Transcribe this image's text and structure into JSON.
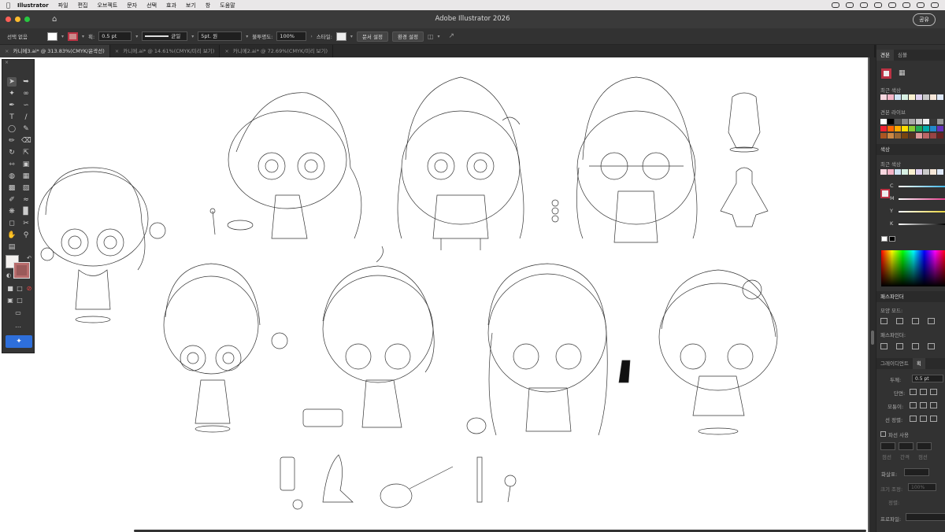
{
  "menubar": {
    "app_name": "Illustrator",
    "items": [
      "파일",
      "편집",
      "오브젝트",
      "문자",
      "선택",
      "효과",
      "보기",
      "창",
      "도움말"
    ],
    "clock": ""
  },
  "window": {
    "title": "Adobe Illustrator 2026",
    "share_label": "공유"
  },
  "control_bar": {
    "selection_label": "선택 없음",
    "stroke_label": "획:",
    "stroke_value": "0.5 pt",
    "profile_label": "균일",
    "brush_value": "5pt. 원",
    "opacity_label": "불투명도:",
    "opacity_value": "100%",
    "style_label": "스타일:",
    "doc_setup_label": "문서 설정",
    "prefs_label": "환경 설정"
  },
  "tabs": [
    {
      "label": "카니메3.ai* @ 313.83%(CMYK/윤곽선)",
      "active": true
    },
    {
      "label": "카니메.ai* @ 14.61%(CMYK/미리 보기)",
      "active": false
    },
    {
      "label": "카니메2.ai* @ 72.69%(CMYK/미리 보기)",
      "active": false
    }
  ],
  "panels": {
    "swatches_tabs": [
      "견본",
      "심볼"
    ],
    "recent_colors_label": "최근 색상",
    "swatch_library_label": "견본 라이브",
    "color_header": "색상",
    "color_recent_label": "최근 색상",
    "cmyk": [
      {
        "channel": "C",
        "color": "#3bb4e6"
      },
      {
        "channel": "M",
        "color": "#e63b8c"
      },
      {
        "channel": "Y",
        "color": "#e6d23b"
      },
      {
        "channel": "K",
        "color": "#888888"
      }
    ],
    "pathfinder_header": "패스파인더",
    "shape_modes_label": "모양 모드:",
    "pathfinders_label": "패스파인더:",
    "gradient_tab": "그레이디언트",
    "stroke_tab": "획",
    "weight_label": "두께:",
    "weight_value": "0.5 pt",
    "cap_label": "단면:",
    "corner_label": "모퉁이:",
    "align_label": "선 정렬:",
    "dashed_label": "파선 사용",
    "arrow_label": "화살표:",
    "scale_label": "크기 조정:",
    "align2_label": "정렬:",
    "profile_label": "프로파일:",
    "dash_cols": [
      "점선",
      "간격",
      "점선"
    ],
    "scale_value": "100%"
  },
  "colors": {
    "fill": "#f4f1ef",
    "stroke": "#9a5a5a",
    "accent": "#2e6fdb"
  }
}
